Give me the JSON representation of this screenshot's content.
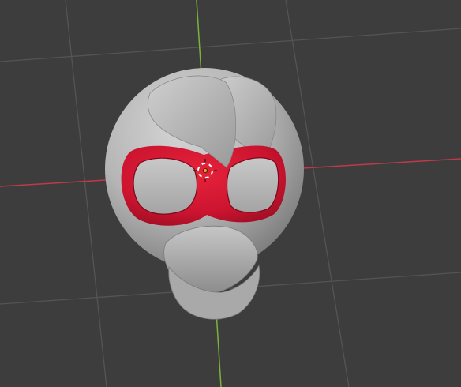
{
  "viewport": {
    "view": "3D Viewport",
    "background_color": "#3d3d3d",
    "grid_color": "#545454",
    "x_axis_color": "#c0394a",
    "y_axis_color": "#7ab33a"
  },
  "model": {
    "base_material_color": "#b3b3b3",
    "mask_material_color": "#d01530"
  },
  "cursor": {
    "icon": "3d-cursor-icon",
    "ring_colors": [
      "#c93a3a",
      "#ffffff"
    ]
  },
  "origin": {
    "icon": "object-origin-icon",
    "color": "#ff9a1f"
  }
}
